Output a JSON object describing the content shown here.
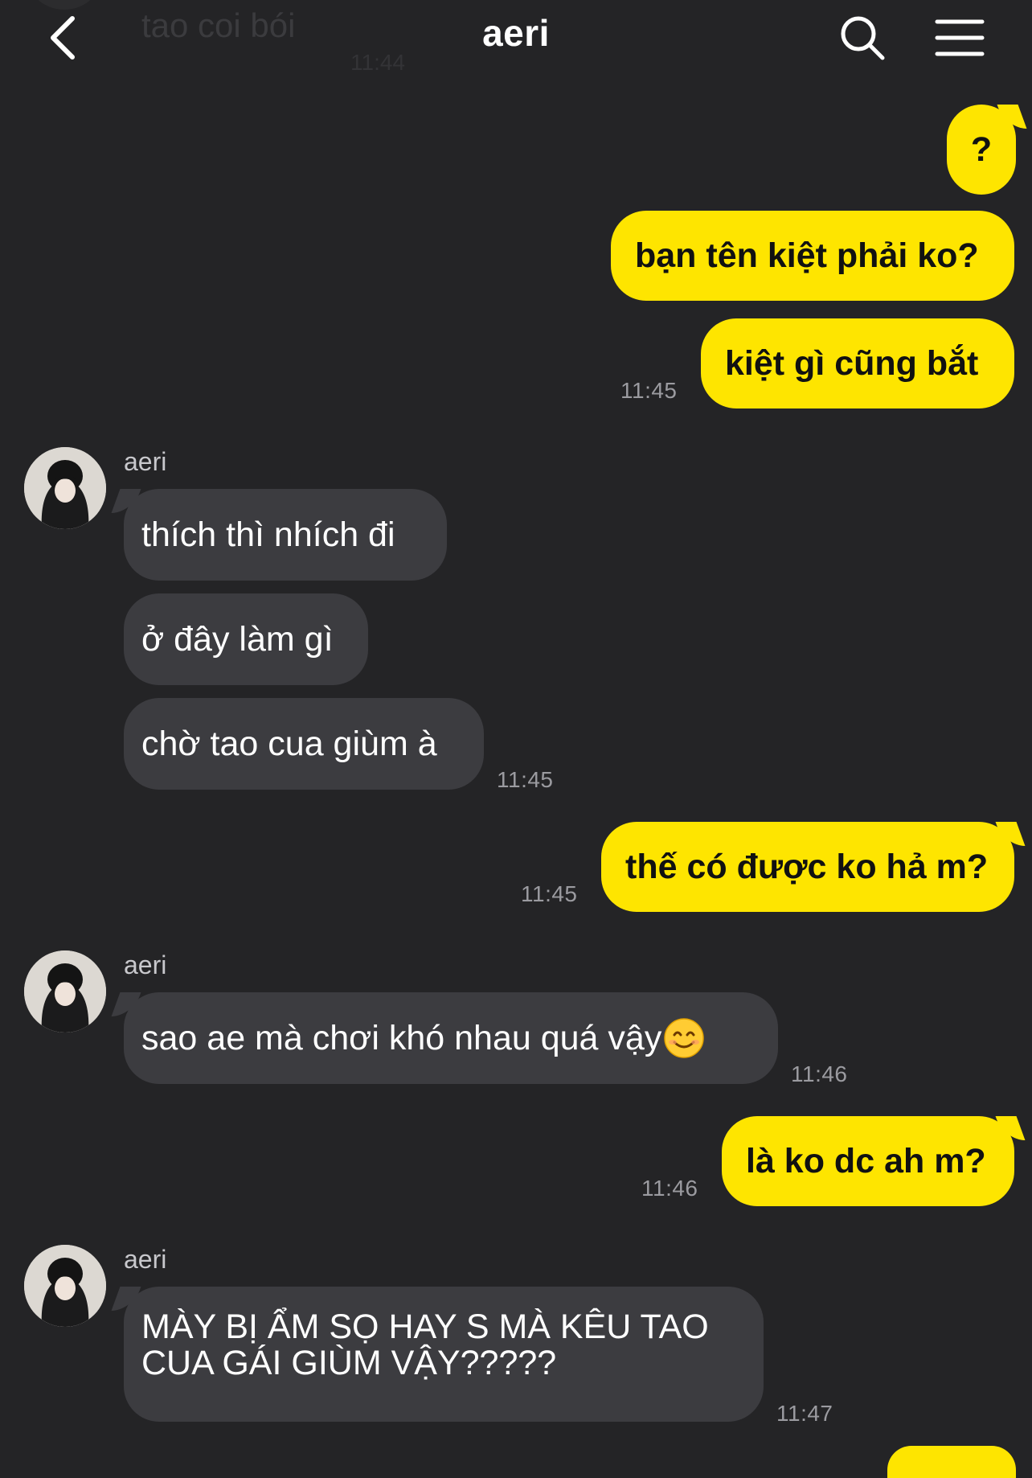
{
  "header": {
    "title": "aeri",
    "back_icon": "chevron-left-icon",
    "search_icon": "search-icon",
    "menu_icon": "hamburger-menu-icon"
  },
  "previous_message": {
    "text": "tao coi bói",
    "time": "11:44"
  },
  "colors": {
    "background": "#242426",
    "my_bubble": "#fee500",
    "their_bubble": "#3c3c40",
    "timestamp": "#9b9ba0"
  },
  "messages": [
    {
      "from": "me",
      "text": "?"
    },
    {
      "from": "me",
      "text": "bạn tên kiệt phải ko?"
    },
    {
      "from": "me",
      "text": "kiệt gì cũng bắt",
      "time": "11:45"
    },
    {
      "from": "aeri",
      "sender": "aeri",
      "text": "thích thì nhích đi"
    },
    {
      "from": "aeri",
      "text": "ở đây làm gì"
    },
    {
      "from": "aeri",
      "text": "chờ tao cua giùm à",
      "time": "11:45"
    },
    {
      "from": "me",
      "text": "thế có được ko hả m?",
      "time": "11:45"
    },
    {
      "from": "aeri",
      "sender": "aeri",
      "text": "sao ae mà chơi khó nhau quá vậy",
      "emoji": "smiling-face-emoji",
      "time": "11:46"
    },
    {
      "from": "me",
      "text": "là ko dc ah m?",
      "time": "11:46"
    },
    {
      "from": "aeri",
      "sender": "aeri",
      "text": "MÀY BỊ ẨM SỌ HAY S MÀ KÊU TAO CUA GÁI GIÙM VẬY?????",
      "time": "11:47"
    }
  ]
}
